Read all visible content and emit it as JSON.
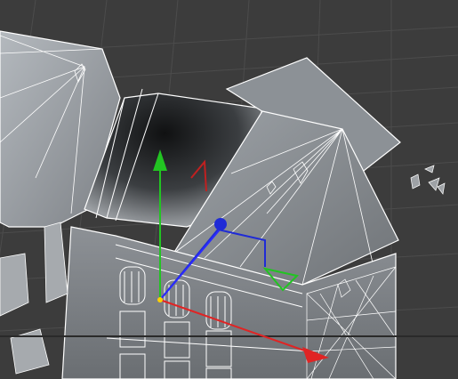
{
  "viewport": {
    "kind": "3d-viewport",
    "content": "building-model-wireframe-on-shaded",
    "colors": {
      "background": "#3c3c3c",
      "grid": "#4a4a4a",
      "model_fill": "#8f9499",
      "model_dark": "#202224",
      "model_edge": "#ffffff",
      "axis_x": "#e02424",
      "axis_y": "#22c422",
      "axis_z": "#2a2aff",
      "rotate_ring": "#1f2bd6",
      "scale_handle": "#22c422"
    },
    "gizmo": {
      "type": "move-rotate-scale-gizmo",
      "axes": [
        "x",
        "y",
        "z"
      ]
    }
  }
}
